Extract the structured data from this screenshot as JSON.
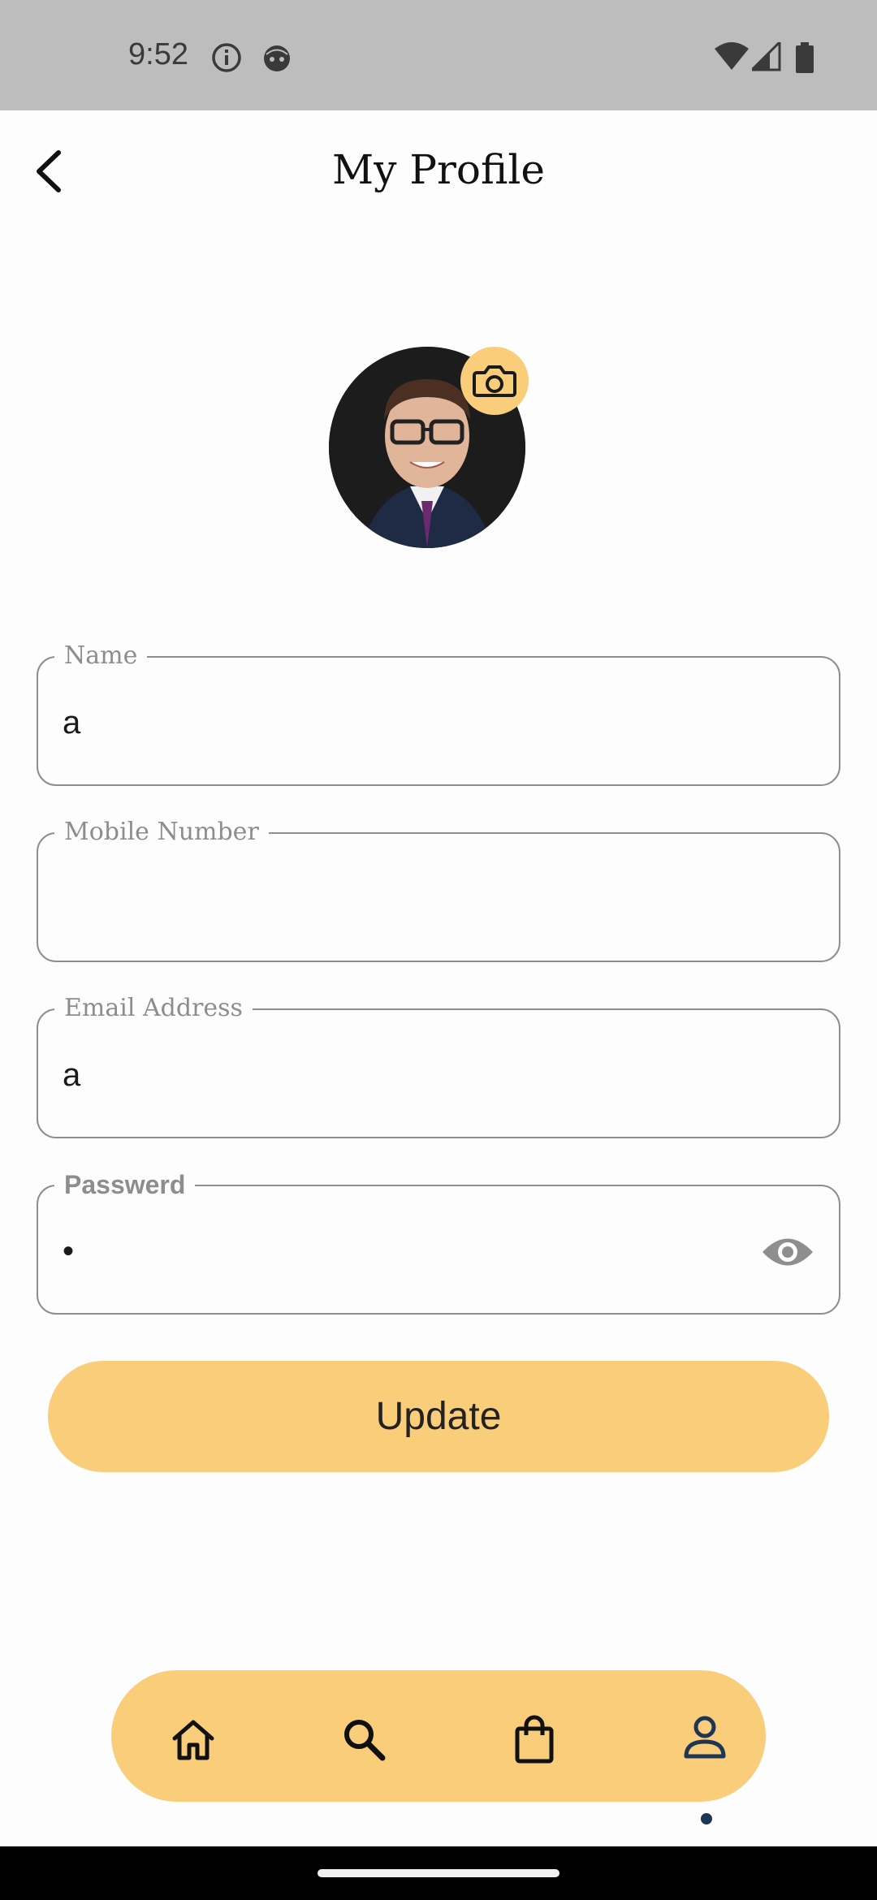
{
  "status_bar": {
    "time": "9:52",
    "icons": [
      "info-icon",
      "face-icon",
      "wifi-icon",
      "signal-icon",
      "battery-icon"
    ]
  },
  "header": {
    "title": "My Profile",
    "back_icon": "chevron-left-icon"
  },
  "profile": {
    "camera_icon": "camera-icon",
    "accent_color": "#f9cd79"
  },
  "form": {
    "name": {
      "label": "Name",
      "value": "a"
    },
    "mobile": {
      "label": "Mobile Number",
      "value": ""
    },
    "email": {
      "label": "Email Address",
      "value": "a"
    },
    "password": {
      "label": "Passwerd",
      "value": "•",
      "toggle_icon": "eye-icon"
    }
  },
  "actions": {
    "update_label": "Update"
  },
  "bottom_nav": {
    "items": [
      "home-icon",
      "search-icon",
      "bag-icon",
      "profile-icon"
    ],
    "active": "profile-icon"
  }
}
